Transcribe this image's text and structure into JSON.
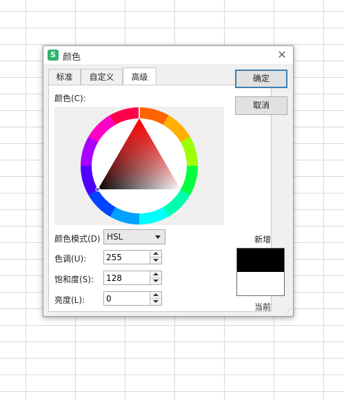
{
  "dialog": {
    "title": "颜色",
    "app_icon_letter": "S",
    "close_symbol": "✕"
  },
  "tabs": [
    {
      "label": "标准",
      "active": false
    },
    {
      "label": "自定义",
      "active": false
    },
    {
      "label": "高级",
      "active": true
    }
  ],
  "color_label": "颜色(C):",
  "mode": {
    "label": "颜色模式(D)",
    "value": "HSL"
  },
  "fields": {
    "hue": {
      "label": "色调(U):",
      "value": "255"
    },
    "saturation": {
      "label": "饱和度(S):",
      "value": "128"
    },
    "luminance": {
      "label": "亮度(L):",
      "value": "0"
    }
  },
  "buttons": {
    "ok": "确定",
    "cancel": "取消"
  },
  "preview": {
    "new_label": "新增",
    "current_label": "当前",
    "new_color": "#000000",
    "current_color": "#ffffff"
  },
  "colors": {
    "accent": "#3c7fb1",
    "app_icon": "#2fb36b",
    "dialog_bg": "#f0f0f0"
  }
}
